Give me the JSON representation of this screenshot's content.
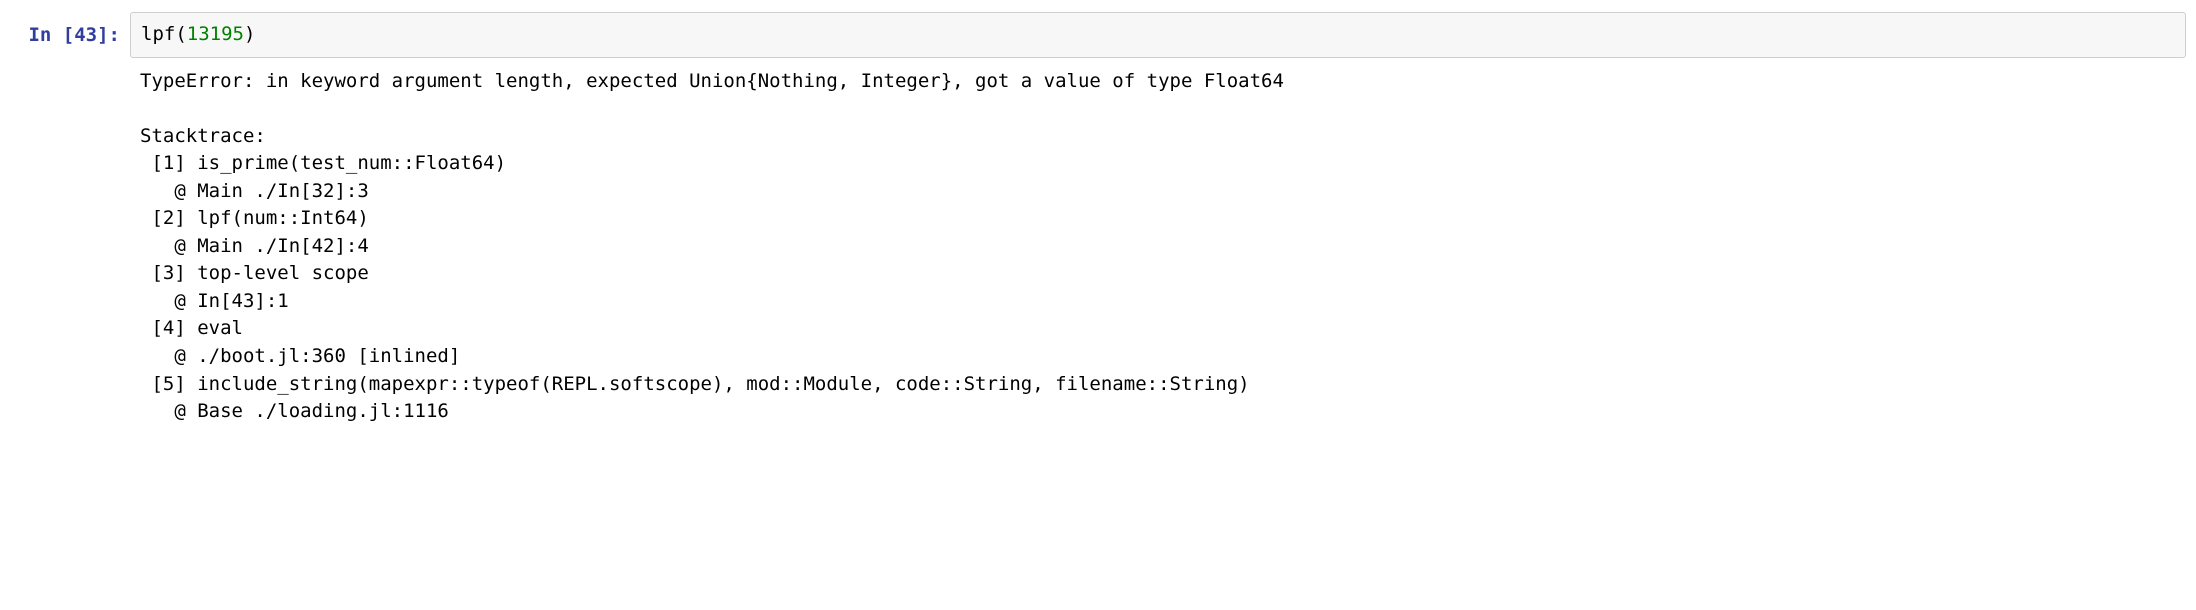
{
  "prompt": {
    "label_prefix": "In [",
    "number": "43",
    "label_suffix": "]:"
  },
  "input_code": {
    "func": "lpf",
    "open": "(",
    "arg": "13195",
    "close": ")"
  },
  "output": {
    "error_line": "TypeError: in keyword argument length, expected Union{Nothing, Integer}, got a value of type Float64",
    "blank1": "",
    "stacktrace_header": "Stacktrace:",
    "frames": [
      " [1] is_prime(test_num::Float64)",
      "   @ Main ./In[32]:3",
      " [2] lpf(num::Int64)",
      "   @ Main ./In[42]:4",
      " [3] top-level scope",
      "   @ In[43]:1",
      " [4] eval",
      "   @ ./boot.jl:360 [inlined]",
      " [5] include_string(mapexpr::typeof(REPL.softscope), mod::Module, code::String, filename::String)",
      "   @ Base ./loading.jl:1116"
    ]
  }
}
